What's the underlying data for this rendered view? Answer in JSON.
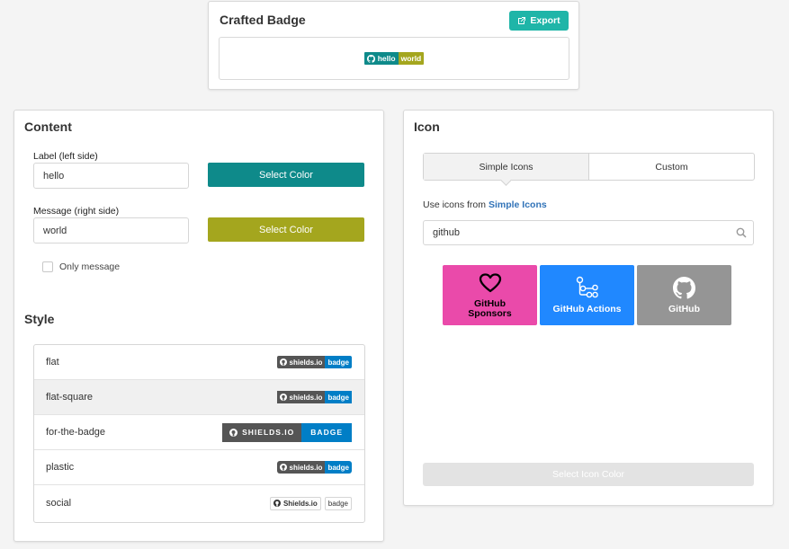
{
  "crafted": {
    "title": "Crafted Badge",
    "export_label": "Export",
    "preview": {
      "label": "hello",
      "message": "world",
      "label_color": "#0e8a8a",
      "message_color": "#a4a61e"
    }
  },
  "content": {
    "title": "Content",
    "label_field": {
      "label": "Label (left side)",
      "value": "hello",
      "color_button": "Select Color",
      "color": "#0e8a8a"
    },
    "message_field": {
      "label": "Message (right side)",
      "value": "world",
      "color_button": "Select Color",
      "color": "#a4a61e"
    },
    "only_message": {
      "label": "Only message",
      "checked": false
    }
  },
  "style": {
    "title": "Style",
    "options": [
      {
        "name": "flat",
        "label": "shields.io",
        "message": "badge",
        "selected": false
      },
      {
        "name": "flat-square",
        "label": "shields.io",
        "message": "badge",
        "selected": true
      },
      {
        "name": "for-the-badge",
        "label": "SHIELDS.IO",
        "message": "BADGE",
        "selected": false
      },
      {
        "name": "plastic",
        "label": "shields.io",
        "message": "badge",
        "selected": false
      },
      {
        "name": "social",
        "label": "Shields.io",
        "message": "badge",
        "selected": false
      }
    ]
  },
  "icon": {
    "title": "Icon",
    "tabs": {
      "simple": "Simple Icons",
      "custom": "Custom"
    },
    "use_icons_prefix": "Use icons from",
    "use_icons_link": "Simple Icons",
    "search": {
      "value": "github",
      "placeholder": ""
    },
    "results": [
      {
        "name": "GitHub Sponsors",
        "color": "#ea4aaa",
        "icon": "heart-icon"
      },
      {
        "name": "GitHub Actions",
        "color": "#2088ff",
        "icon": "github-actions-icon"
      },
      {
        "name": "GitHub",
        "color": "#959595",
        "icon": "github-icon"
      }
    ],
    "select_color_label": "Select Icon Color"
  }
}
